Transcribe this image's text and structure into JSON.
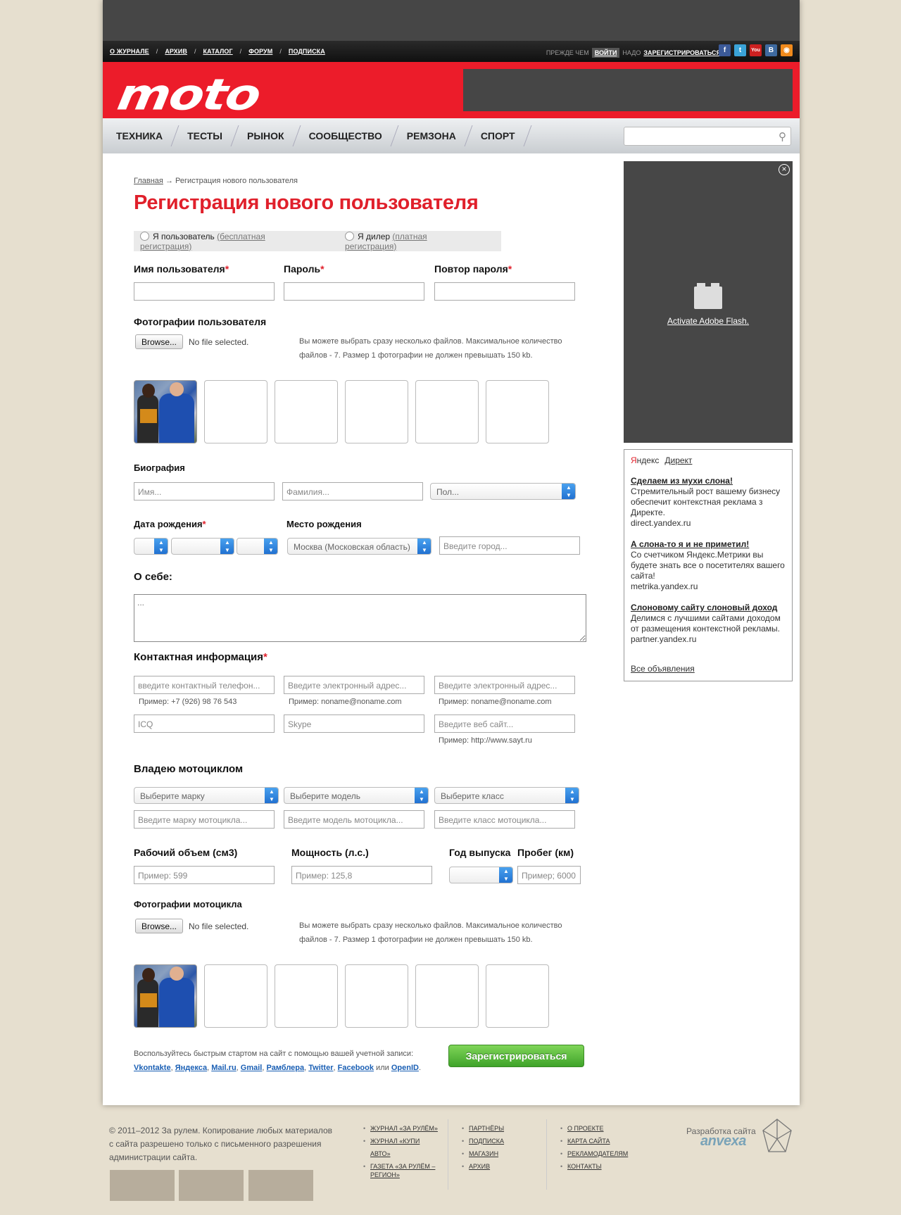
{
  "top_nav": [
    "О ЖУРНАЛЕ",
    "АРХИВ",
    "КАТАЛОГ",
    "ФОРУМ",
    "ПОДПИСКА"
  ],
  "top_nav_sep": "/",
  "auth": {
    "before": "ПРЕЖДЕ ЧЕМ",
    "login": "ВОЙТИ",
    "need": "НАДО",
    "register": "ЗАРЕГИСТРИРОВАТЬСЯ"
  },
  "social_icons": [
    {
      "name": "facebook-icon",
      "glyph": "f",
      "color": "#3b5998"
    },
    {
      "name": "twitter-icon",
      "glyph": "t",
      "color": "#3aa3d8"
    },
    {
      "name": "youtube-icon",
      "glyph": "You",
      "color": "#cc2020"
    },
    {
      "name": "vkontakte-icon",
      "glyph": "B",
      "color": "#3e6aa0"
    },
    {
      "name": "rss-icon",
      "glyph": "◉",
      "color": "#f08a1c"
    }
  ],
  "logo": "moto",
  "main_nav": [
    "ТЕХНИКА",
    "ТЕСТЫ",
    "РЫНОК",
    "СООБЩЕСТВО",
    "РЕМЗОНА",
    "СПОРТ"
  ],
  "search": {
    "placeholder": "",
    "icon": "search-icon"
  },
  "breadcrumb": {
    "home": "Главная",
    "arrow": "→",
    "current": "Регистрация нового пользователя"
  },
  "page_title": "Регистрация нового пользователя",
  "account_type": {
    "user_label": "Я пользователь",
    "user_note": "(бесплатная регистрация)",
    "dealer_label": "Я дилер",
    "dealer_note": "(платная регистрация)"
  },
  "fields": {
    "username": "Имя пользователя",
    "password": "Пароль",
    "password_repeat": "Повтор пароля",
    "required_mark": "*",
    "user_photos": "Фотографии пользователя",
    "browse": "Browse...",
    "no_file": "No file selected.",
    "photos_note": "Вы можете выбрать сразу несколько файлов. Максимальное количество файлов - 7. Размер 1 фотографии не должен превышать 150 kb.",
    "biography": "Биография",
    "first_name_ph": "Имя...",
    "last_name_ph": "Фамилия...",
    "gender_ph": "Пол...",
    "birth_date": "Дата рождения",
    "birth_place": "Место рождения",
    "region_value": "Москва (Московская область)",
    "city_ph": "Введите город...",
    "about": "О себе:",
    "about_ph": "...",
    "contacts": "Контактная информация",
    "phone_ph": "введите контактный телефон...",
    "phone_hint": "Пример: +7 (926) 98 76 543",
    "email_ph": "Введите электронный адрес...",
    "email_hint": "Пример: noname@noname.com",
    "email2_ph": "Введите электронный адрес...",
    "email2_hint": "Пример: noname@noname.com",
    "icq_ph": "ICQ",
    "skype_ph": "Skype",
    "site_ph": "Введите веб сайт...",
    "site_hint": "Пример: http://www.sayt.ru",
    "own_moto": "Владею мотоциклом",
    "brand_sel": "Выберите марку",
    "model_sel": "Выберите модель",
    "class_sel": "Выберите класс",
    "brand_ph": "Введите марку мотоцикла...",
    "model_ph": "Введите модель мотоцикла...",
    "class_ph": "Введите класс мотоцикла...",
    "volume": "Рабочий объем (см3)",
    "power": "Мощность (л.с.)",
    "year": "Год выпуска",
    "mileage": "Пробег (км)",
    "volume_ph": "Пример: 599",
    "power_ph": "Пример: 125,8",
    "mileage_ph": "Пример; 6000",
    "moto_photos": "Фотографии мотоцикла"
  },
  "quick_start": {
    "text": "Воспользуйтесь быстрым стартом на сайт с помощью вашей учетной записи:",
    "services": [
      "Vkontakte",
      "Яндекса",
      "Mail.ru",
      "Gmail",
      "Рамблера",
      "Twitter",
      "Facebook"
    ],
    "or": "или",
    "last": "OpenID",
    "end": "."
  },
  "register_button": "Зарегистрироваться",
  "flash": {
    "text": "Activate Adobe Flash."
  },
  "yandex": {
    "ya_first": "Я",
    "ya_rest": "ндекс",
    "direct": "Директ",
    "ads": [
      {
        "title": "Сделаем из мухи слона!",
        "body": "Стремительный рост вашему бизнесу обеспечит контекстная реклама з Директе.",
        "domain": "direct.yandex.ru"
      },
      {
        "title": "А слона-то я и не приметил!",
        "body": "Со счетчиком Яндекс.Метрики вы будете знать все о посетителях вашего сайта!",
        "domain": "metrika.yandex.ru"
      },
      {
        "title": "Слоновому сайту слоновый доход",
        "body": "Делимся с лучшими сайтами доходом от размещения контекстной рекламы.",
        "domain": "partner.yandex.ru"
      }
    ],
    "all": "Все объявления"
  },
  "footer": {
    "copyright": "© 2011–2012 За рулем. Копирование любых материалов с сайта разрешено только с письменного разрешения администрации сайта.",
    "col1": [
      "ЖУРНАЛ «ЗА РУЛЁМ»",
      "ЖУРНАЛ «КУПИ АВТО»",
      "ГАЗЕТА «ЗА РУЛЁМ – РЕГИОН»"
    ],
    "col2": [
      "ПАРТНЁРЫ",
      "ПОДПИСКА",
      "МАГАЗИН",
      "АРХИВ"
    ],
    "col3": [
      "О ПРОЕКТЕ",
      "КАРТА САЙТА",
      "РЕКЛАМОДАТЕЛЯМ",
      "КОНТАКТЫ"
    ],
    "dev_label": "Разработка сайта",
    "dev_brand": "anvexa"
  }
}
